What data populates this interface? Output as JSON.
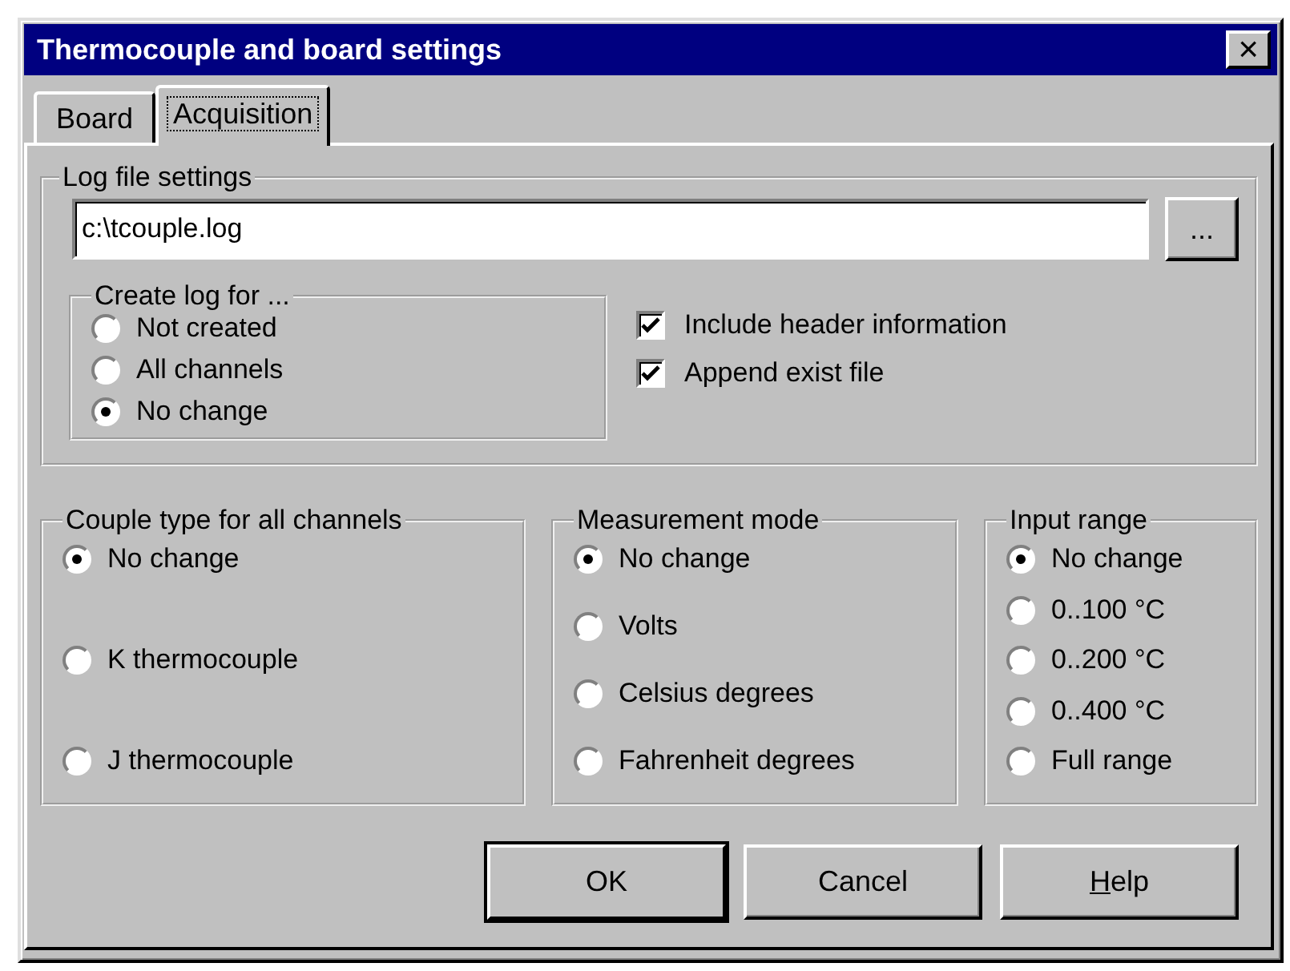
{
  "window": {
    "title": "Thermocouple and board settings",
    "close": "×"
  },
  "tabs": [
    {
      "label": "Board",
      "selected": false
    },
    {
      "label": "Acquisition",
      "selected": true
    }
  ],
  "log_file_settings": {
    "title": "Log file settings",
    "path": "c:\\tcouple.log",
    "browse": "...",
    "create_log": {
      "title": "Create log for ...",
      "options": [
        {
          "label": "Not created",
          "selected": false
        },
        {
          "label": "All channels",
          "selected": false
        },
        {
          "label": "No change",
          "selected": true
        }
      ]
    },
    "checkboxes": [
      {
        "label": "Include header information",
        "checked": true
      },
      {
        "label": "Append exist file",
        "checked": true
      }
    ]
  },
  "groups": [
    {
      "title": "Couple type for all channels",
      "options": [
        {
          "label": "No change",
          "selected": true
        },
        {
          "label": "K thermocouple",
          "selected": false
        },
        {
          "label": "J thermocouple",
          "selected": false
        }
      ]
    },
    {
      "title": "Measurement mode",
      "options": [
        {
          "label": "No change",
          "selected": true
        },
        {
          "label": "Volts",
          "selected": false
        },
        {
          "label": "Celsius degrees",
          "selected": false
        },
        {
          "label": "Fahrenheit degrees",
          "selected": false
        }
      ]
    },
    {
      "title": "Input range",
      "options": [
        {
          "label": "No change",
          "selected": true
        },
        {
          "label": "0..100 °C",
          "selected": false
        },
        {
          "label": "0..200 °C",
          "selected": false
        },
        {
          "label": "0..400 °C",
          "selected": false
        },
        {
          "label": "Full range",
          "selected": false
        }
      ]
    }
  ],
  "buttons": [
    {
      "default": true,
      "label_parts": [
        {
          "text": "OK",
          "underlined": false
        }
      ]
    },
    {
      "default": false,
      "label_parts": [
        {
          "text": "Cancel",
          "underlined": false
        }
      ]
    },
    {
      "default": false,
      "label_parts": [
        {
          "text": "H",
          "underlined": true
        },
        {
          "text": "elp",
          "underlined": false
        }
      ]
    }
  ]
}
